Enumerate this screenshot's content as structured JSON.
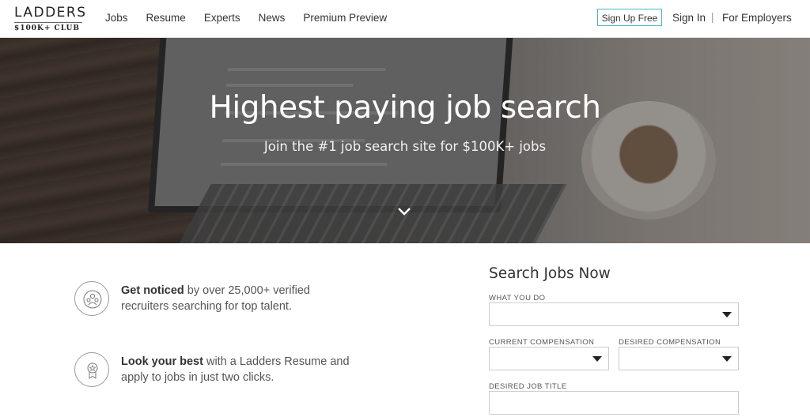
{
  "header": {
    "logo_main": "LADDERS",
    "logo_sub": "$100K+ CLUB",
    "nav": [
      "Jobs",
      "Resume",
      "Experts",
      "News",
      "Premium Preview"
    ],
    "signup_label": "Sign Up Free",
    "signin_label": "Sign In",
    "separator": "|",
    "employers_label": "For Employers"
  },
  "hero": {
    "title": "Highest paying job search",
    "subtitle": "Join the #1 job search site for $100K+ jobs",
    "scroll_icon": "chevron-down-icon"
  },
  "features": [
    {
      "icon": "recruiters-icon",
      "bold": "Get noticed",
      "text": " by over 25,000+ verified recruiters searching for top talent."
    },
    {
      "icon": "award-icon",
      "bold": "Look your best",
      "text": " with a Ladders Resume and apply to jobs in just two clicks."
    }
  ],
  "search": {
    "title": "Search Jobs Now",
    "what_label": "WHAT YOU DO",
    "current_comp_label": "CURRENT COMPENSATION",
    "desired_comp_label": "DESIRED COMPENSATION",
    "desired_title_label": "DESIRED JOB TITLE"
  }
}
